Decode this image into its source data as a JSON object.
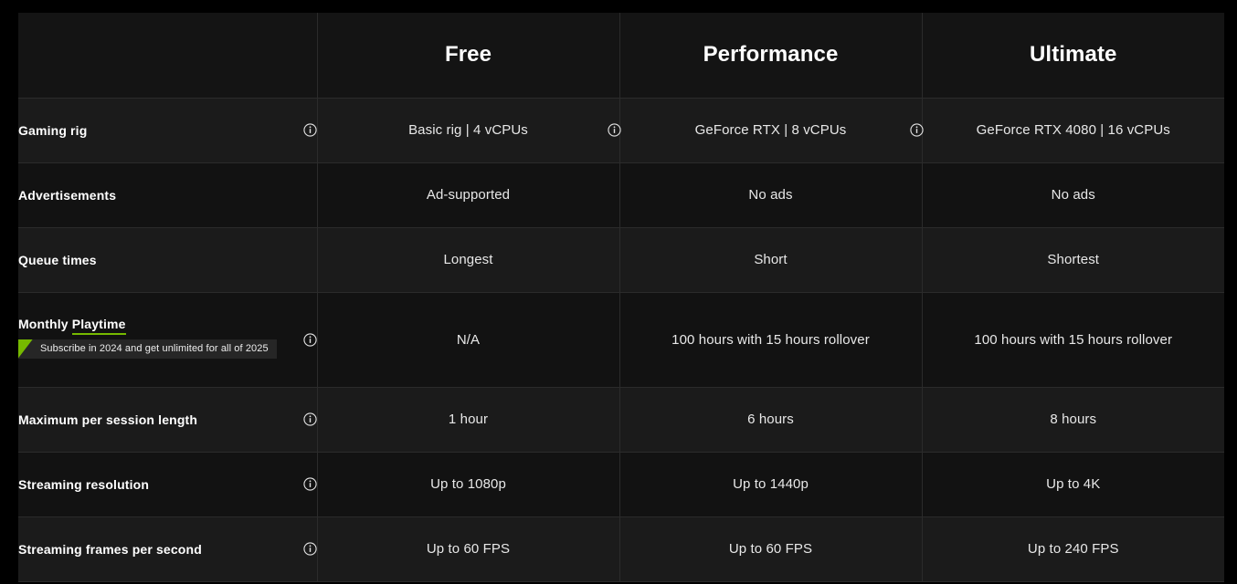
{
  "theme": {
    "page_background": "#000000",
    "row_background_alt": "#1b1b1b",
    "row_background_base": "#121212",
    "header_background": "#141414",
    "border_color": "#2b2b2b",
    "accent_green": "#76b900",
    "text_primary": "#ffffff",
    "text_secondary": "#e8e8e8"
  },
  "table": {
    "label_column_header": "",
    "plans": [
      {
        "name": "Free"
      },
      {
        "name": "Performance"
      },
      {
        "name": "Ultimate"
      }
    ],
    "icons": {
      "info": "info-icon"
    },
    "rows": [
      {
        "label": "Gaming rig",
        "label_info_icon": true,
        "values": [
          {
            "text": "Basic rig | 4 vCPUs",
            "info_icon": true
          },
          {
            "text": "GeForce RTX | 8 vCPUs",
            "info_icon": true
          },
          {
            "text": "GeForce RTX 4080 | 16 vCPUs",
            "info_icon": false
          }
        ]
      },
      {
        "label": "Advertisements",
        "label_info_icon": false,
        "values": [
          {
            "text": "Ad-supported",
            "info_icon": false
          },
          {
            "text": "No ads",
            "info_icon": false
          },
          {
            "text": "No ads",
            "info_icon": false
          }
        ]
      },
      {
        "label": "Queue times",
        "label_info_icon": false,
        "values": [
          {
            "text": "Longest",
            "info_icon": false
          },
          {
            "text": "Short",
            "info_icon": false
          },
          {
            "text": "Shortest",
            "info_icon": false
          }
        ]
      },
      {
        "label_prefix": "Monthly ",
        "label_highlight": "Playtime",
        "label_info_icon": true,
        "badge": "Subscribe in 2024 and get unlimited for all of 2025",
        "values": [
          {
            "text": "N/A",
            "info_icon": false
          },
          {
            "text": "100 hours with 15 hours rollover",
            "info_icon": false
          },
          {
            "text": "100 hours with 15 hours rollover",
            "info_icon": false
          }
        ]
      },
      {
        "label": "Maximum per session length",
        "label_info_icon": true,
        "values": [
          {
            "text": "1 hour",
            "info_icon": false
          },
          {
            "text": "6 hours",
            "info_icon": false
          },
          {
            "text": "8 hours",
            "info_icon": false
          }
        ]
      },
      {
        "label": "Streaming resolution",
        "label_info_icon": true,
        "values": [
          {
            "text": "Up to 1080p",
            "info_icon": false
          },
          {
            "text": "Up to 1440p",
            "info_icon": false
          },
          {
            "text": "Up to 4K",
            "info_icon": false
          }
        ]
      },
      {
        "label": "Streaming frames per second",
        "label_info_icon": true,
        "values": [
          {
            "text": "Up to 60 FPS",
            "info_icon": false
          },
          {
            "text": "Up to 60 FPS",
            "info_icon": false
          },
          {
            "text": "Up to 240 FPS",
            "info_icon": false
          }
        ]
      }
    ]
  }
}
